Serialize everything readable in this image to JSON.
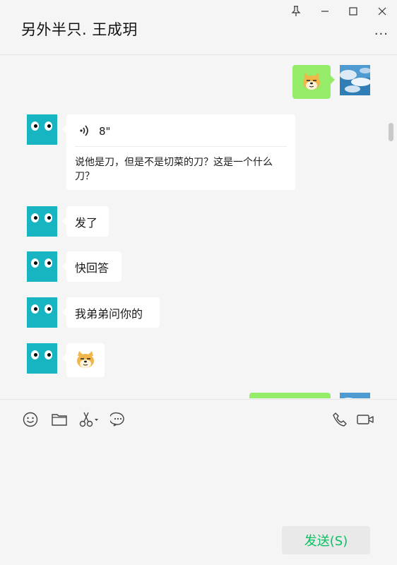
{
  "header": {
    "title": "另外半只. 王成玥",
    "more": "···"
  },
  "window_controls": [
    "pin-icon",
    "minimize-icon",
    "maximize-icon",
    "close-icon"
  ],
  "messages": [
    {
      "side": "right",
      "type": "sticker",
      "content": "cat-sticker"
    },
    {
      "side": "left",
      "type": "voice",
      "duration": "8\"",
      "transcript_line1": "说他是刀，但是不是切菜的刀？这是一个什么",
      "transcript_line2": "刀？"
    },
    {
      "side": "left",
      "type": "text",
      "text": "发了"
    },
    {
      "side": "left",
      "type": "text",
      "text": "快回答"
    },
    {
      "side": "left",
      "type": "text",
      "text": "我弟弟问你的"
    },
    {
      "side": "left",
      "type": "sticker",
      "content": "cat-sticker"
    },
    {
      "side": "right",
      "type": "text",
      "text": ""
    }
  ],
  "toolbar": {
    "left_tools": [
      "emoji-icon",
      "folder-icon",
      "scissors-icon",
      "chat-bubble-icon"
    ],
    "right_tools": [
      "phone-icon",
      "video-icon"
    ]
  },
  "compose": {
    "send_label": "发送(S)"
  },
  "colors": {
    "accent": "#07c160",
    "bubble_self": "#95ec69",
    "avatar": "#17b5c1",
    "background": "#f5f5f5"
  }
}
